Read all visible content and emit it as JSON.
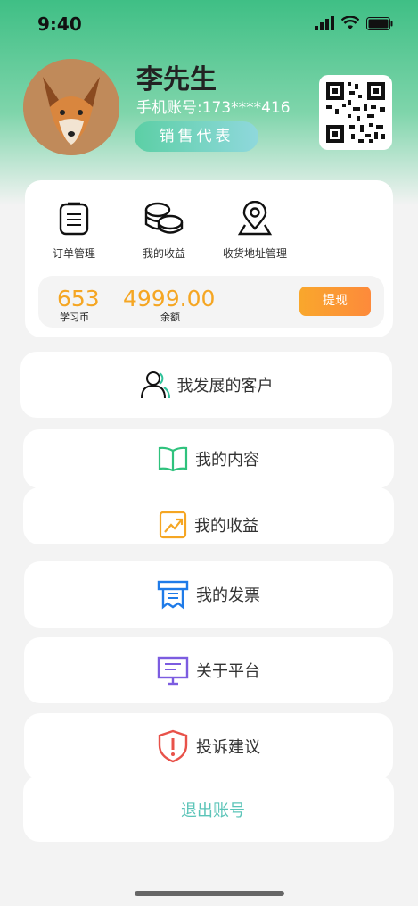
{
  "status_bar": {
    "time": "9:40"
  },
  "profile": {
    "name": "李先生",
    "phone": "手机账号:173****416",
    "role": "销售代表"
  },
  "shortcuts": [
    {
      "label": "订单管理",
      "icon": "order-list-icon"
    },
    {
      "label": "我的收益",
      "icon": "coins-icon"
    },
    {
      "label": "收货地址管理",
      "icon": "location-pin-icon"
    }
  ],
  "wallet": {
    "coins_value": "653",
    "coins_label": "学习币",
    "balance_value": "4999.00",
    "balance_label": "余额",
    "withdraw_label": "提现"
  },
  "menu": [
    {
      "label": "我发展的客户",
      "icon": "customers-icon"
    },
    {
      "label": "我的内容",
      "icon": "book-icon"
    },
    {
      "label": "我的收益",
      "icon": "trend-chart-icon"
    },
    {
      "label": "我的发票",
      "icon": "invoice-icon"
    },
    {
      "label": "关于平台",
      "icon": "board-icon"
    },
    {
      "label": "投诉建议",
      "icon": "warning-shield-icon"
    }
  ],
  "logout_label": "退出账号",
  "colors": {
    "accent_green": "#3fbf85",
    "orange": "#f5a623",
    "teal": "#5bc4b8"
  }
}
